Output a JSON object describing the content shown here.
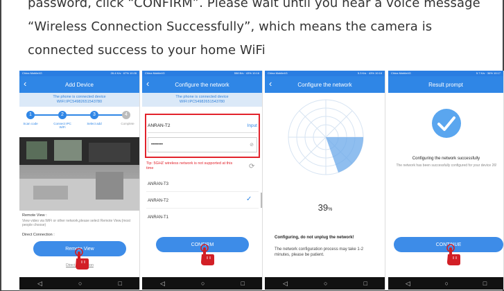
{
  "instructions": [
    "password, click “CONFIRM”. Please wait until you hear a voice message",
    "“Wireless Connection Successfully”, which means the camera is",
    "connected success to your home WiFi"
  ],
  "status": {
    "p1": {
      "left": "China Mobile4G",
      "right": "26.4 K/s · 67% 10:28"
    },
    "p2": {
      "left": "China Mobile4G",
      "right": "558 B/s · 43% 10:16"
    },
    "p3": {
      "left": "China Mobile4G",
      "right": "5.3 K/s · 43% 10:16"
    },
    "p4": {
      "left": "China Mobile4G",
      "right": "5.7 K/s · 36% 10:17"
    }
  },
  "screen1": {
    "title": "Add Device",
    "info_line1": "The phone is connected device",
    "info_line2": "WIFI:IPC54982651543780",
    "steps": [
      "1",
      "2",
      "3",
      "4"
    ],
    "step_labels": [
      "Scan code",
      "Connect IPC WiFi",
      "Select add",
      "Complete"
    ],
    "remote_view": "Remote View :",
    "remote_desc": "View video via WiFi or other network,please select Remote View.(most people choose)",
    "direct_conn": "Direct Connection :",
    "remote_btn": "Remote View",
    "direct_link": "Direct Connection"
  },
  "screen2": {
    "title": "Configure the network",
    "info_line1": "The phone is connected device",
    "info_line2": "WIFI:IPC54982651543780",
    "ssid_value": "ANRAN-T2",
    "input_label": "Input",
    "password_value": "••••••••",
    "tip": "Tip: 5GHZ wireless network is not supported at this time",
    "networks": [
      "ANRAN-T3",
      "ANRAN-T2",
      "ANRAN-T1"
    ],
    "confirm_btn": "CONFIRM"
  },
  "screen3": {
    "title": "Configure the network",
    "percent": "39",
    "percent_unit": "%",
    "warning": "Configuring, do not unplug the network!",
    "note": "The network configuration process may take 1-2 minutes, please be patient."
  },
  "screen4": {
    "title": "Result prompt",
    "success_title": "Configuring the network successfully",
    "success_desc": "The network has been successfully configured for your device 26!",
    "continue_btn": "CONTINUE"
  },
  "navbar": {
    "back": "◁",
    "home": "○",
    "recent": "□"
  },
  "colors": {
    "primary": "#2f86e6",
    "alert": "#e2222b",
    "hand": "#d21f26"
  }
}
